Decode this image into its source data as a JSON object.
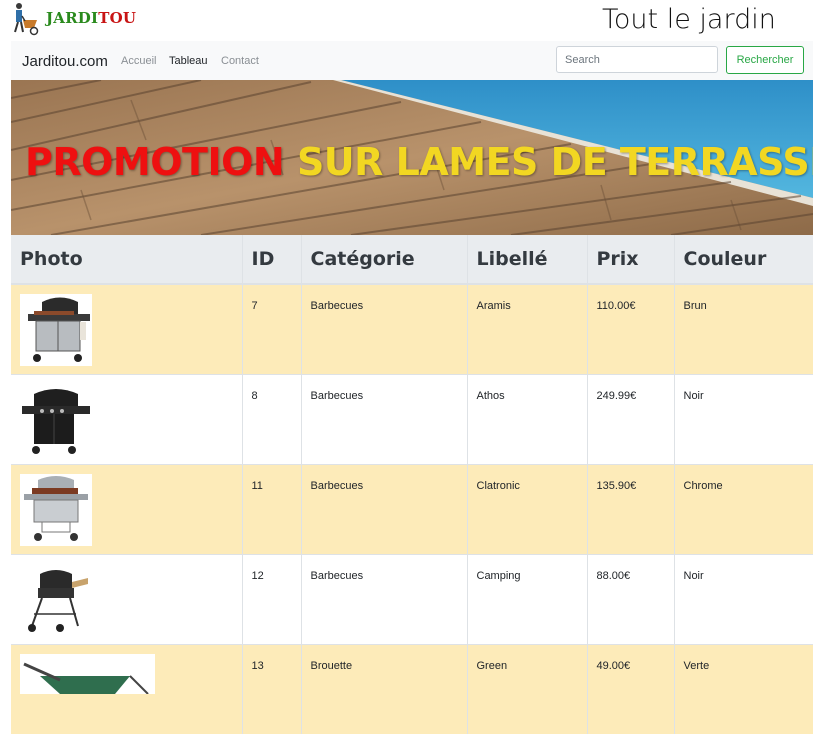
{
  "header": {
    "logo_text_a": "JARDI",
    "logo_text_b": "TOU",
    "site_title": "Tout le jardin"
  },
  "navbar": {
    "brand": "Jarditou.com",
    "links": [
      "Accueil",
      "Tableau",
      "Contact"
    ],
    "active_link": "Tableau",
    "search_placeholder": "Search",
    "search_button": "Rechercher"
  },
  "banner": {
    "promo_red": "PROMOTION",
    "promo_yellow": "SUR LAMES DE TERRASSE"
  },
  "table": {
    "headers": [
      "Photo",
      "ID",
      "Catégorie",
      "Libellé",
      "Prix",
      "Couleur"
    ],
    "rows": [
      {
        "photo": "barbecue-grill-icon",
        "id": "7",
        "categorie": "Barbecues",
        "libelle": "Aramis",
        "prix": "110.00€",
        "couleur": "Brun"
      },
      {
        "photo": "barbecue-grill-icon",
        "id": "8",
        "categorie": "Barbecues",
        "libelle": "Athos",
        "prix": "249.99€",
        "couleur": "Noir"
      },
      {
        "photo": "barbecue-grill-icon",
        "id": "11",
        "categorie": "Barbecues",
        "libelle": "Clatronic",
        "prix": "135.90€",
        "couleur": "Chrome"
      },
      {
        "photo": "barbecue-grill-icon",
        "id": "12",
        "categorie": "Barbecues",
        "libelle": "Camping",
        "prix": "88.00€",
        "couleur": "Noir"
      },
      {
        "photo": "wheelbarrow-icon",
        "id": "13",
        "categorie": "Brouette",
        "libelle": "Green",
        "prix": "49.00€",
        "couleur": "Verte"
      }
    ]
  },
  "colors": {
    "logo_green": "#2a8a1d",
    "logo_red": "#c81414",
    "promo_red": "#ee1010",
    "promo_yellow": "#f2d722",
    "row_highlight": "#fdebb9",
    "button_green": "#28a745"
  }
}
